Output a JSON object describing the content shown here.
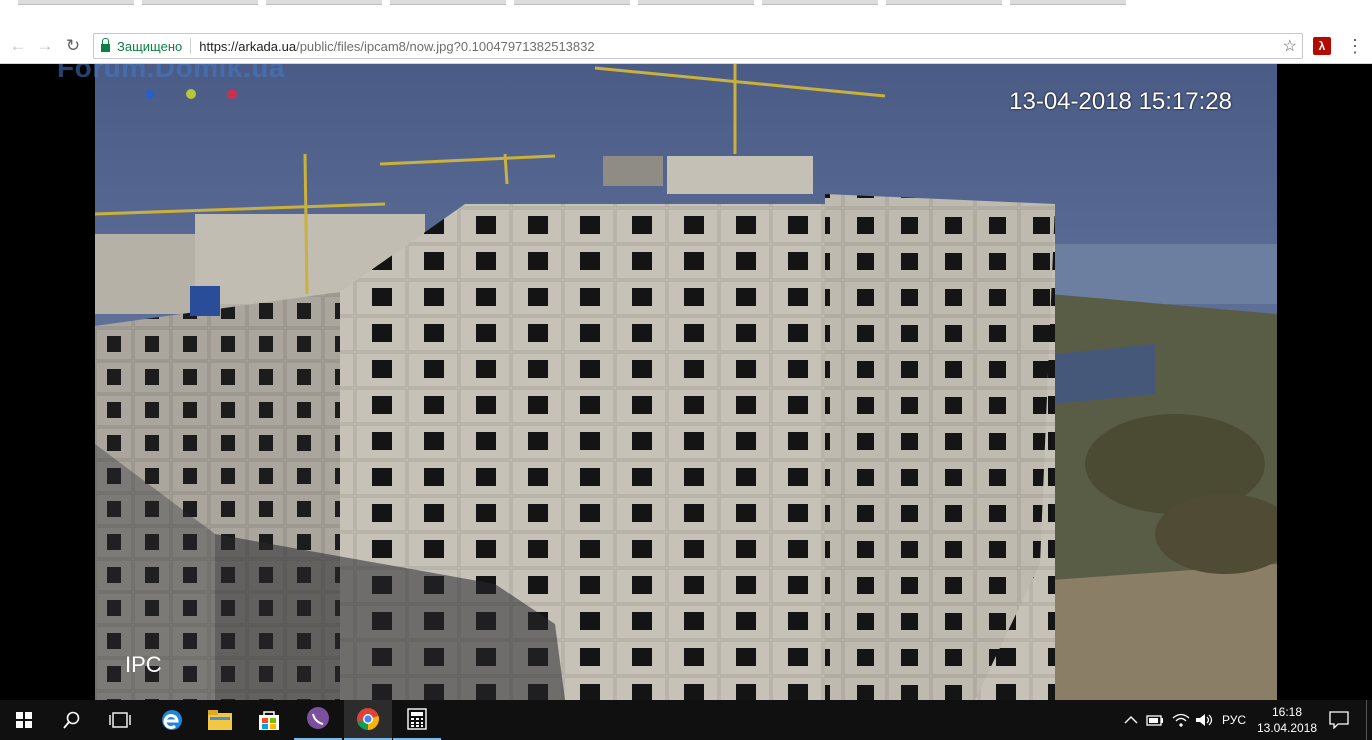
{
  "browser": {
    "security_label": "Защищено",
    "url_host": "https://arkada.ua",
    "url_path": "/public/files/ipcam8/now.jpg?0.10047971382513832",
    "icons": {
      "back": "back-arrow-icon",
      "forward": "forward-arrow-icon",
      "reload": "reload-icon",
      "lock": "lock-icon",
      "bookmark": "star-icon",
      "pdf_extension": "acrobat-icon",
      "menu": "kebab-menu-icon"
    }
  },
  "image": {
    "watermark": "Forum.Domik.ua",
    "timestamp": "13-04-2018 15:17:28",
    "camera_label": "IPC"
  },
  "taskbar": {
    "items": [
      {
        "name": "start",
        "icon": "windows-logo-icon"
      },
      {
        "name": "search",
        "icon": "search-icon"
      },
      {
        "name": "task-view",
        "icon": "task-view-icon"
      },
      {
        "name": "edge",
        "icon": "edge-browser-icon"
      },
      {
        "name": "explorer",
        "icon": "folder-icon"
      },
      {
        "name": "store",
        "icon": "store-bag-icon"
      },
      {
        "name": "viber",
        "icon": "viber-icon"
      },
      {
        "name": "chrome",
        "icon": "chrome-icon"
      },
      {
        "name": "calculator",
        "icon": "calculator-icon"
      }
    ],
    "language": "РУС",
    "time": "16:18",
    "date": "13.04.2018",
    "colors": {
      "accent": "#76b9ed",
      "background": "#101010"
    }
  }
}
